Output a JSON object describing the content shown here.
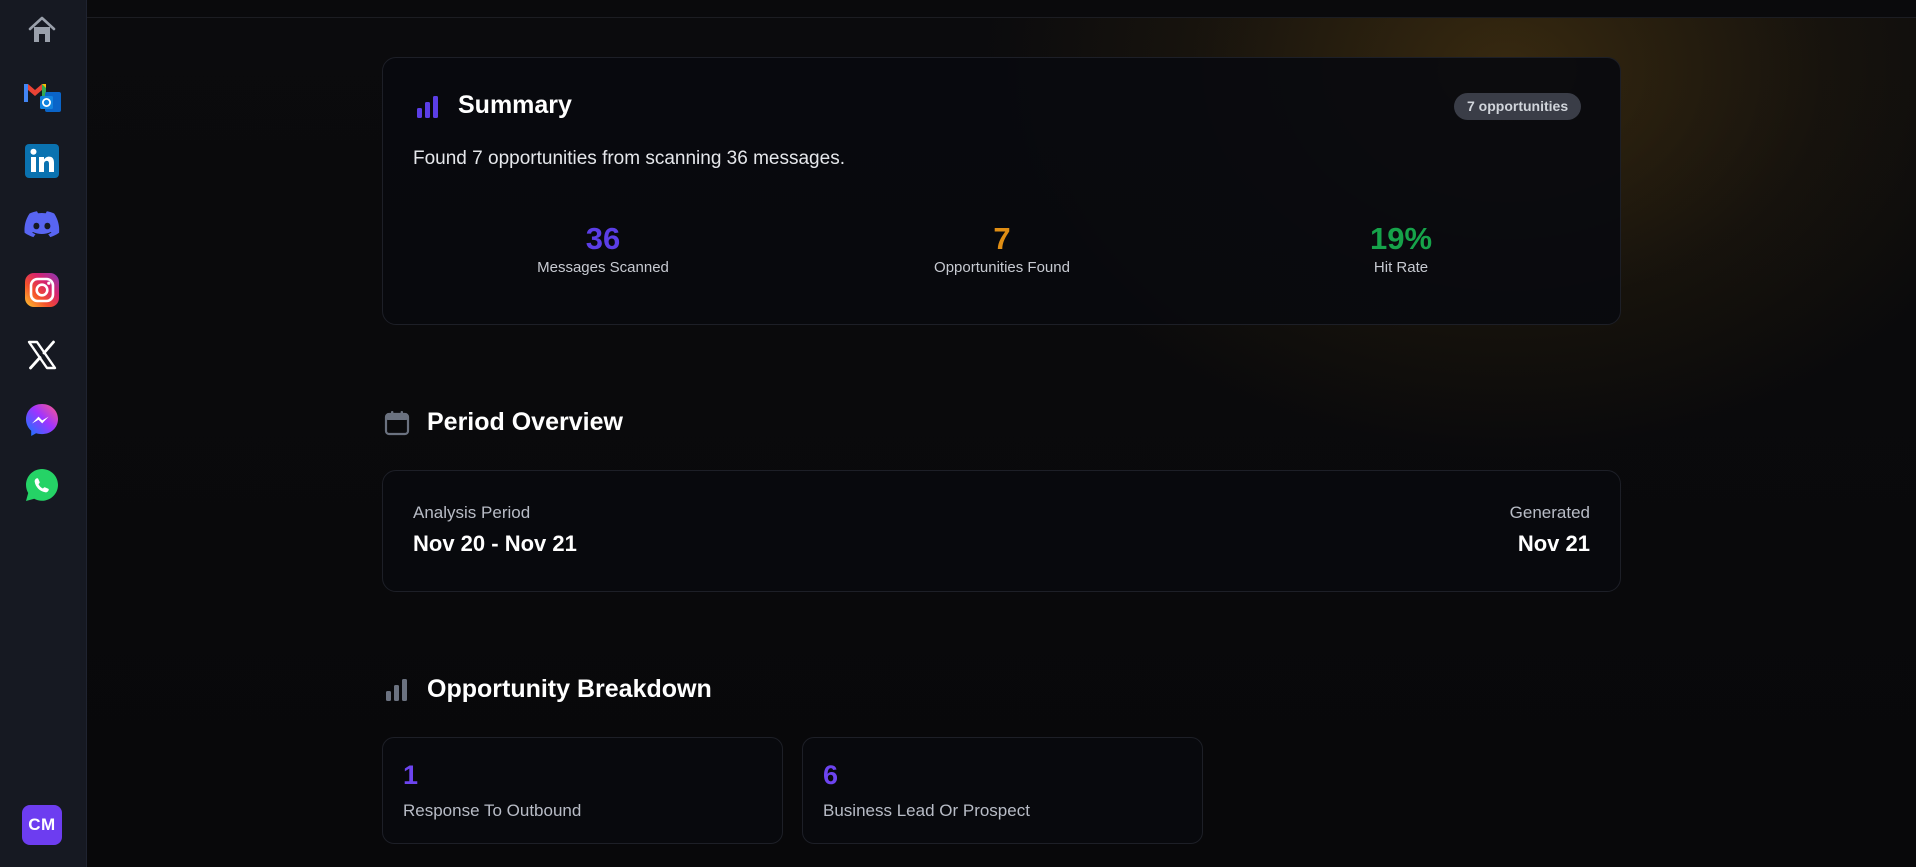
{
  "sidebar": {
    "icons": [
      "home-icon",
      "gmail-outlook-icon",
      "linkedin-icon",
      "discord-icon",
      "instagram-icon",
      "x-icon",
      "messenger-icon",
      "whatsapp-icon"
    ],
    "avatar_initials": "CM"
  },
  "summary": {
    "title": "Summary",
    "badge": "7 opportunities",
    "text": "Found 7 opportunities from scanning 36 messages.",
    "stats": [
      {
        "value": "36",
        "label": "Messages Scanned",
        "color": "#5b3ee6"
      },
      {
        "value": "7",
        "label": "Opportunities Found",
        "color": "#e08e14"
      },
      {
        "value": "19%",
        "label": "Hit Rate",
        "color": "#16a34a"
      }
    ]
  },
  "period_overview": {
    "title": "Period Overview",
    "analysis_label": "Analysis Period",
    "analysis_value": "Nov 20 - Nov 21",
    "generated_label": "Generated",
    "generated_value": "Nov 21"
  },
  "breakdown": {
    "title": "Opportunity Breakdown",
    "items": [
      {
        "count": "1",
        "label": "Response To Outbound"
      },
      {
        "count": "6",
        "label": "Business Lead Or Prospect"
      }
    ]
  },
  "colors": {
    "accent": "#6d44f0",
    "sidebar_bg": "#161922"
  }
}
